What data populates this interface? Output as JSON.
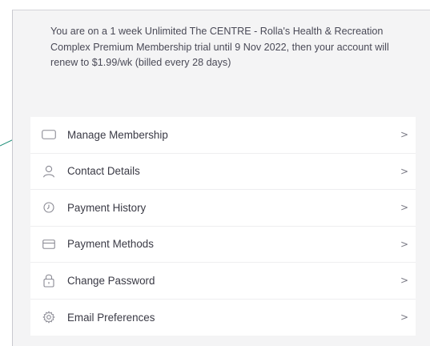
{
  "trial_notice": "You are on a 1 week Unlimited The CENTRE - Rolla's Health & Recreation Complex Premium Membership trial until 9 Nov 2022, then your account will renew to $1.99/wk (billed every 28 days)",
  "menu": {
    "items": [
      {
        "label": "Manage Membership",
        "icon": "membership-card-icon"
      },
      {
        "label": "Contact Details",
        "icon": "user-icon"
      },
      {
        "label": "Payment History",
        "icon": "clock-icon"
      },
      {
        "label": "Payment Methods",
        "icon": "credit-card-icon"
      },
      {
        "label": "Change Password",
        "icon": "lock-icon"
      },
      {
        "label": "Email Preferences",
        "icon": "gear-icon"
      }
    ],
    "chevron": ">"
  },
  "colors": {
    "panel_bg": "#f4f4f5",
    "text": "#4a4a57",
    "icon": "#8a8a94",
    "pointer_line": "#1d8f78"
  }
}
